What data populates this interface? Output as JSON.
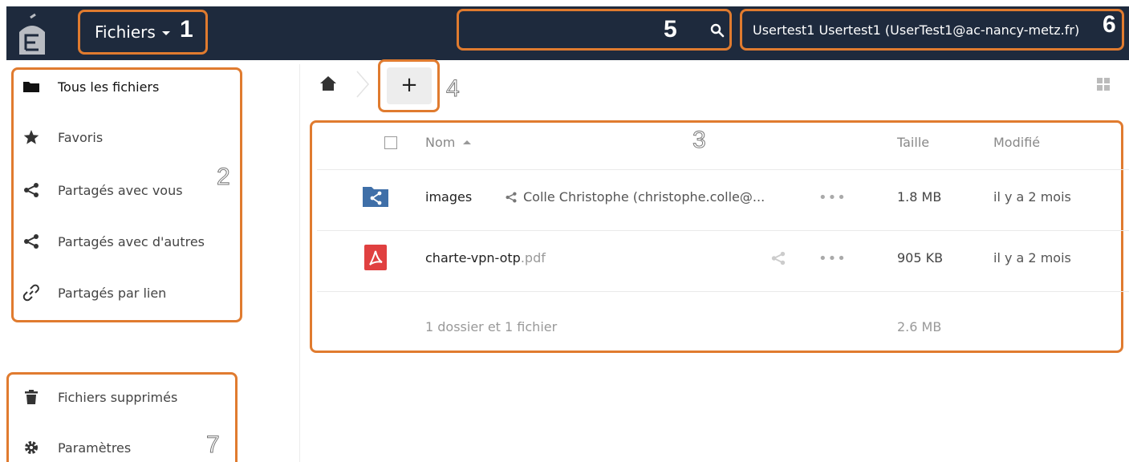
{
  "header": {
    "app_name": "Fichiers",
    "user_label": "Usertest1 Usertest1 (UserTest1@ac-nancy-metz.fr)"
  },
  "annotations": [
    "1",
    "2",
    "3",
    "4",
    "5",
    "6",
    "7"
  ],
  "sidebar": {
    "items": [
      {
        "label": "Tous les fichiers",
        "icon": "folder-icon"
      },
      {
        "label": "Favoris",
        "icon": "star-icon"
      },
      {
        "label": "Partagés avec vous",
        "icon": "share-icon"
      },
      {
        "label": "Partagés avec d'autres",
        "icon": "share-icon"
      },
      {
        "label": "Partagés par lien",
        "icon": "link-icon"
      }
    ],
    "footer_items": [
      {
        "label": "Fichiers supprimés",
        "icon": "trash-icon"
      },
      {
        "label": "Paramètres",
        "icon": "gear-icon"
      }
    ]
  },
  "toolbar": {
    "new_label": "+"
  },
  "table": {
    "columns": {
      "name": "Nom",
      "size": "Taille",
      "modified": "Modifié"
    },
    "rows": [
      {
        "name": "images",
        "ext": "",
        "shared_with": "Colle Christophe (christophe.colle@...",
        "more": "•••",
        "size": "1.8 MB",
        "modified": "il y a 2 mois",
        "icon": "shared-folder-icon"
      },
      {
        "name": "charte-vpn-otp",
        "ext": ".pdf",
        "shared_with": "",
        "more": "•••",
        "size": "905 KB",
        "modified": "il y a 2 mois",
        "icon": "pdf-icon"
      }
    ],
    "summary": {
      "count": "1 dossier et 1 fichier",
      "total": "2.6 MB"
    }
  },
  "colors": {
    "header_bg": "#1e2a3d",
    "annotation": "#e07b2f",
    "folder_blue": "#3f6fa8",
    "pdf_red": "#e04040"
  }
}
